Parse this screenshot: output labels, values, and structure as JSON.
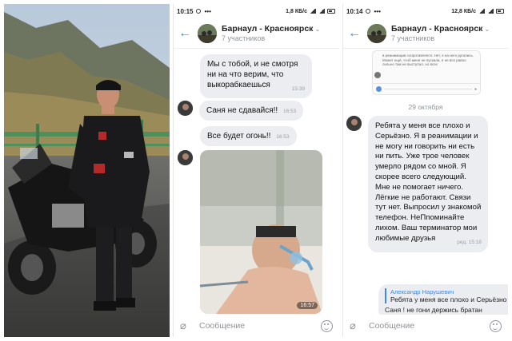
{
  "screen1": {
    "status_time": "10:15",
    "status_speed": "1,8 КБ/с",
    "chat_title": "Барнаул - Красноярск",
    "chat_members": "7 участников",
    "messages": [
      {
        "text": "Мы с тобой, и не смотря ни на что верим, что выкорабкаешься",
        "time": "15:39"
      },
      {
        "text": "Саня не сдавайся!!",
        "time": "16:53"
      },
      {
        "text": "Все будет огонь!!",
        "time": "16:53"
      }
    ],
    "photo_time": "16:57",
    "composer_placeholder": "Сообщение"
  },
  "screen2": {
    "status_time": "10:14",
    "status_speed": "12,8 КБ/с",
    "chat_title": "Барнаул - Красноярск",
    "chat_members": "7 участников",
    "forwarded_snippet": "в реанимации сопротивлялся. Нет, я на него ругались. Может ещё, чтоб меня не пускали, я не все равно сильно там не выступал, но всех",
    "date_separator": "29 октября",
    "long_message": "Ребята у меня все плохо и Серьёзно. Я в реанимации и не могу ни говорить ни есть ни пить. Уже трое человек умерло рядом со мной. Я скорее всего следующий. Мне не помогает ничего. Лёгкие не работают. Связи тут нет. Выпросил у знакомой телефон. НеПпоминайте лихом. Ваш терминатор мои любимые друзья",
    "long_message_time": "ред. 15:18",
    "reply": {
      "quoted_author": "Александр Нарушевич",
      "quoted_text": "Ребята у меня все плохо и Серьёзно",
      "text": "Саня ! не гони держись братан"
    },
    "composer_placeholder": "Сообщение"
  },
  "colors": {
    "accent": "#3f8ae0",
    "bubble_bg": "#ebedf0",
    "muted_text": "#8f9399"
  }
}
